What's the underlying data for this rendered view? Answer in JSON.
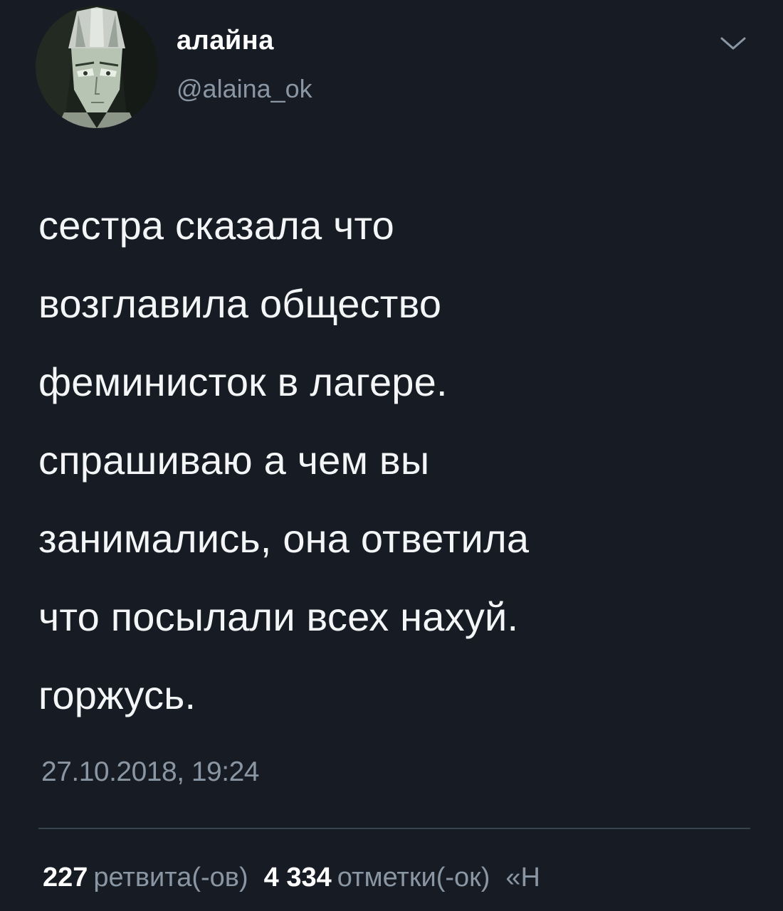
{
  "user": {
    "display_name": "алайна",
    "handle": "@alaina_ok",
    "avatar_icon": "cartoon-character-avatar"
  },
  "header": {
    "menu_icon": "chevron-down-icon"
  },
  "tweet": {
    "lines": [
      "сестра сказала что",
      "возглавила общество",
      "феминисток в лагере.",
      "спрашиваю а чем вы",
      "занимались, она ответила",
      "что посылали всех нахуй.",
      "горжусь."
    ],
    "timestamp": "27.10.2018, 19:24"
  },
  "stats": {
    "retweets_count": "227",
    "retweets_label": "ретвита(-ов)",
    "likes_count": "4 334",
    "likes_label": "отметки(-ок)",
    "trailing": "«Н"
  },
  "colors": {
    "background": "#171c24",
    "secondary_text": "#8a96a3",
    "divider": "#38444d"
  }
}
